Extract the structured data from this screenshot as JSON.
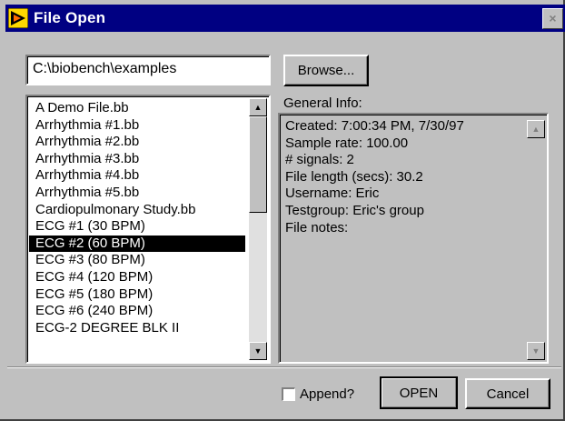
{
  "window": {
    "title": "File Open",
    "close_glyph": "×"
  },
  "path_field": {
    "value": "C:\\biobench\\examples"
  },
  "browse_label": "Browse...",
  "file_list": {
    "items": [
      "A Demo File.bb",
      "Arrhythmia #1.bb",
      "Arrhythmia #2.bb",
      "Arrhythmia #3.bb",
      "Arrhythmia #4.bb",
      "Arrhythmia #5.bb",
      "Cardiopulmonary Study.bb",
      "ECG #1 (30 BPM)",
      "ECG #2 (60 BPM)",
      "ECG #3 (80 BPM)",
      "ECG #4 (120 BPM)",
      "ECG #5 (180 BPM)",
      "ECG #6 (240 BPM)",
      "ECG-2 DEGREE BLK II"
    ],
    "selected": "ECG #2 (60 BPM)",
    "scroll_up_glyph": "▲",
    "scroll_down_glyph": "▼"
  },
  "info": {
    "label": "General Info:",
    "lines": [
      "Created: 7:00:34 PM, 7/30/97",
      "Sample rate: 100.00",
      "# signals: 2",
      "File length (secs): 30.2",
      "Username: Eric",
      "Testgroup: Eric's group",
      "File notes:"
    ],
    "scroll_up_glyph": "▲",
    "scroll_down_glyph": "▼"
  },
  "append": {
    "label": "Append?",
    "checked": false
  },
  "open_label": "OPEN",
  "cancel_label": "Cancel",
  "icons": {
    "title": "labview-vi-icon"
  },
  "colors": {
    "titlebar": "#000082",
    "face": "#c0c0c0",
    "selection": "#000000"
  }
}
